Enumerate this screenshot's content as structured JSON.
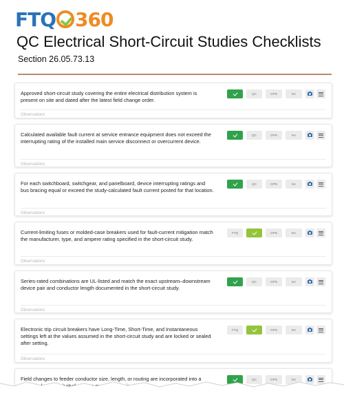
{
  "logo": {
    "text_left": "FTQ",
    "text_right": "360"
  },
  "page_title": "QC Electrical Short-Circuit Studies Checklists",
  "section": "Section 26.05.73.13",
  "colors": {
    "accent_green": "#31a24c",
    "accent_lime": "#93c43b",
    "logo_blue": "#2d72b8",
    "logo_orange": "#f08a24",
    "rule": "#b98a70"
  },
  "observations_placeholder": "Observations",
  "labels": {
    "ftq": "FTQ",
    "qc": "QC",
    "opn": "OPN",
    "na": "NA"
  },
  "items": [
    {
      "text": "Approved short-circuit study covering the entire electrical distribution system is present on site and dated after the latest field change order.",
      "status": "QC"
    },
    {
      "text": "Calculated available fault current at service entrance equipment does not exceed the interrupting rating of the installed main service disconnect or overcurrent device.",
      "status": "QC"
    },
    {
      "text": "For each switchboard, switchgear, and panelboard, device interrupting ratings and bus bracing equal or exceed the study-calculated fault current posted for that location.",
      "status": "QC"
    },
    {
      "text": "Current-limiting fuses or molded-case breakers used for fault-current mitigation match the manufacturer, type, and ampere rating specified in the short-circuit study.",
      "status": "FTQ"
    },
    {
      "text": "Series-rated combinations are UL-listed and match the exact upstream–downstream device pair and conductor length documented in the short-circuit study.",
      "status": "QC"
    },
    {
      "text": "Electronic trip circuit breakers have Long-Time, Short-Time, and Instantaneous settings left at the values assumed in the short-circuit study and are locked or sealed after setting.",
      "status": "FTQ"
    },
    {
      "text": "Field changes to feeder conductor size, length, or routing are incorporated into a revised short-circuit study before system energization.",
      "status": "QC"
    }
  ]
}
